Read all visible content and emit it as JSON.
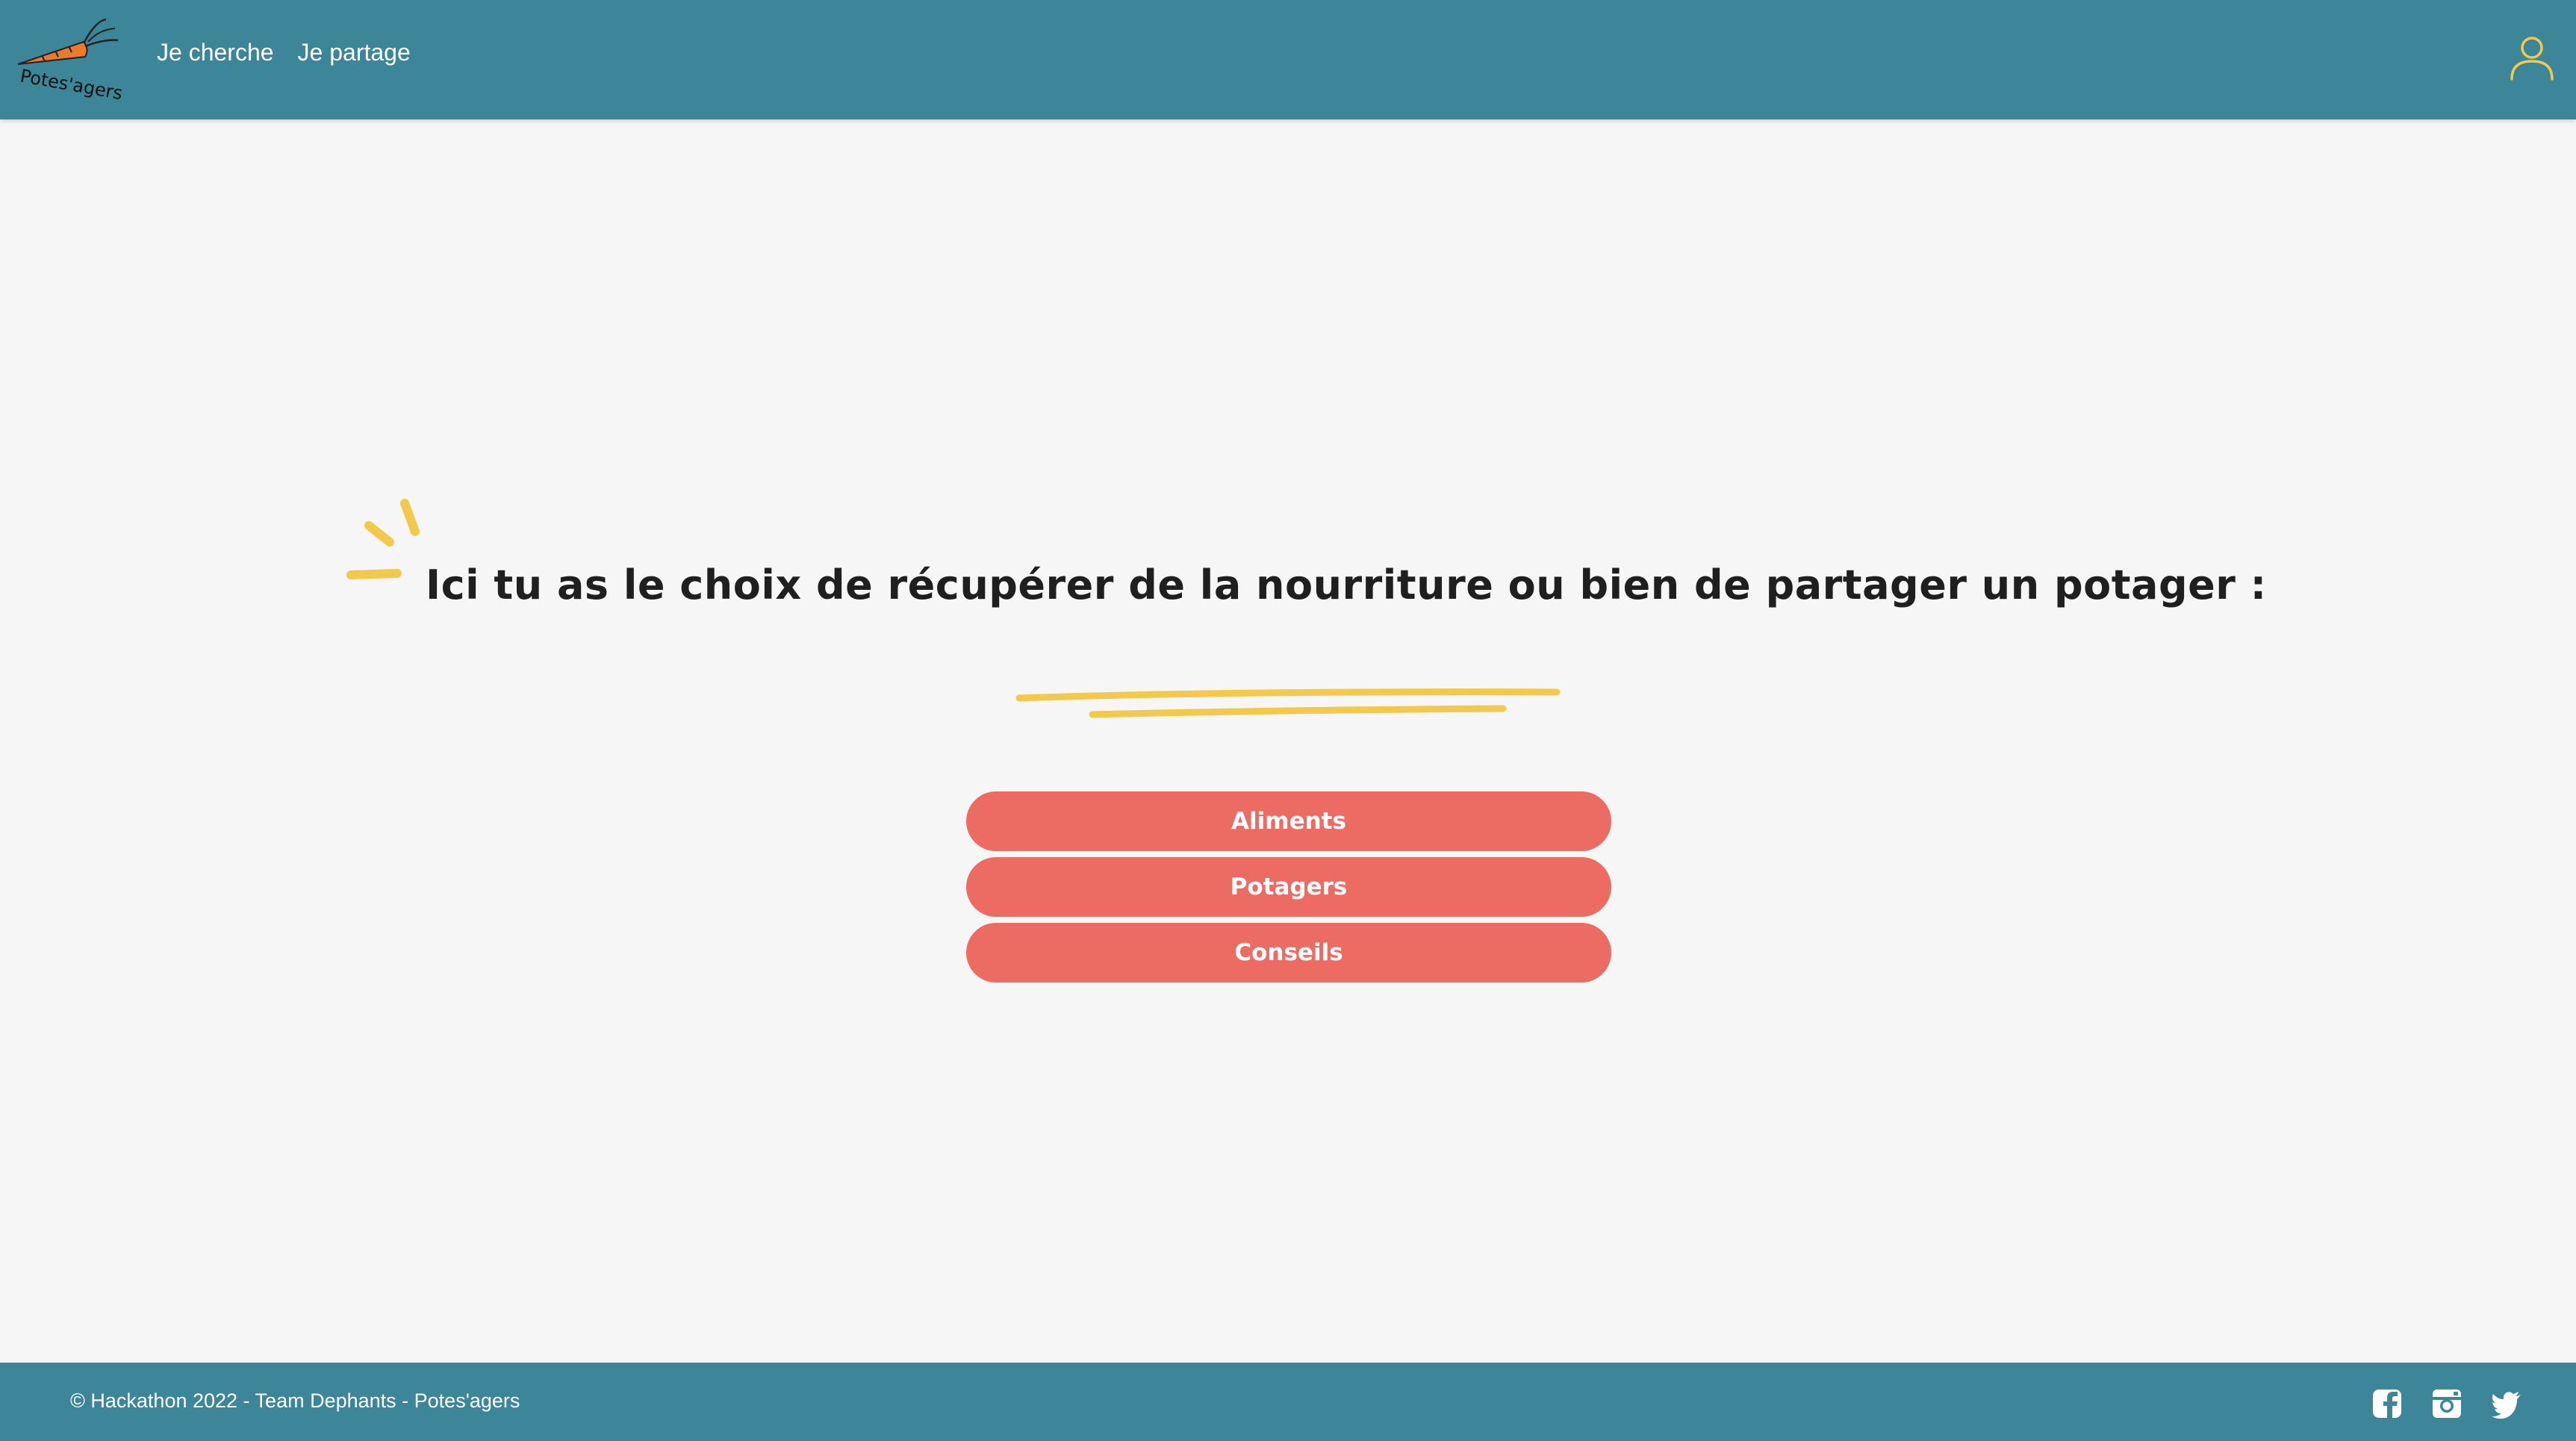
{
  "brand": {
    "logo_text": "Potes'agers"
  },
  "nav": {
    "items": [
      {
        "label": "Je cherche"
      },
      {
        "label": "Je partage"
      }
    ]
  },
  "main": {
    "title": "Ici tu as le choix de récupérer de la nourriture ou bien de partager un potager :",
    "choices": [
      {
        "label": "Aliments"
      },
      {
        "label": "Potagers"
      },
      {
        "label": "Conseils"
      }
    ]
  },
  "footer": {
    "copyright": "© Hackathon 2022 - Team Dephants - Potes'agers",
    "socials": [
      "facebook-icon",
      "instagram-icon",
      "twitter-icon"
    ]
  },
  "colors": {
    "header_bg": "#3d8599",
    "button_bg": "#ec6b62",
    "accent_yellow": "#f2c94c",
    "page_bg": "#f6f6f6",
    "title_text": "#1f1f1f"
  }
}
